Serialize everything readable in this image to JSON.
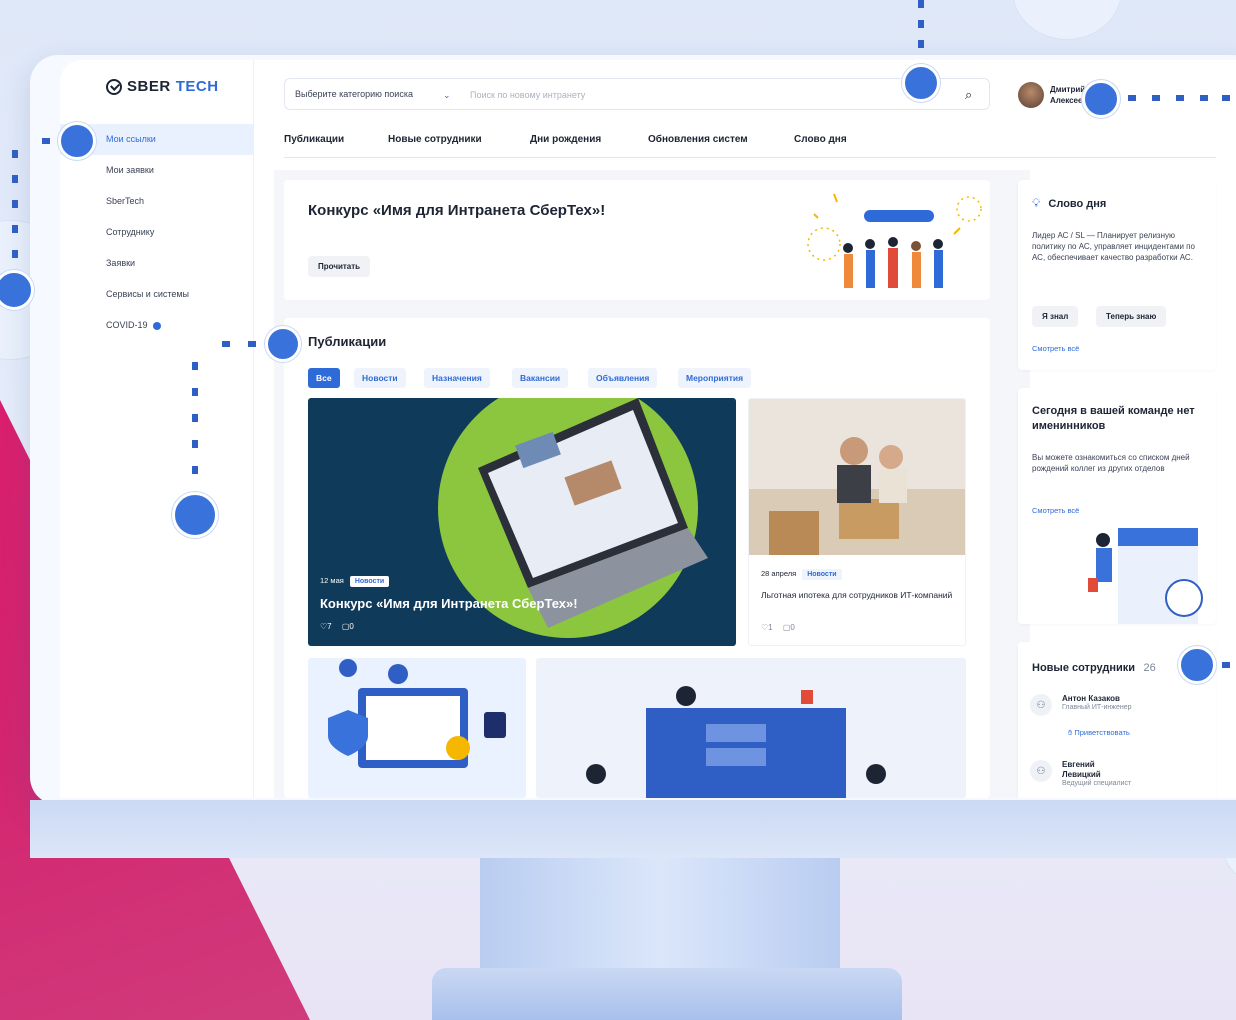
{
  "brand": {
    "part1": "SBER",
    "part2": "TECH"
  },
  "sidebar": {
    "items": [
      {
        "label": "Мои ссылки",
        "active": true
      },
      {
        "label": "Мои заявки"
      },
      {
        "label": "SberTech"
      },
      {
        "label": "Сотруднику"
      },
      {
        "label": "Заявки"
      },
      {
        "label": "Сервисы и системы"
      },
      {
        "label": "COVID-19"
      }
    ]
  },
  "search": {
    "category": "Выберите категорию поиска",
    "placeholder": "Поиск по новому интранету"
  },
  "user": {
    "name_line1": "Дмитрий",
    "name_line2": "Алексеевич"
  },
  "tabs": [
    "Публикации",
    "Новые сотрудники",
    "Дни рождения",
    "Обновления систем",
    "Слово дня"
  ],
  "banner": {
    "title": "Конкурс «Имя для Интранета СберТех»!",
    "button": "Прочитать"
  },
  "publications": {
    "title": "Публикации",
    "filters": [
      "Все",
      "Новости",
      "Назначения",
      "Вакансии",
      "Объявления",
      "Мероприятия"
    ],
    "featured": {
      "date": "12 мая",
      "tag": "Новости",
      "title": "Конкурс «Имя для Интранета СберТех»!",
      "likes": "7",
      "comments": "0"
    },
    "second": {
      "date": "28 апреля",
      "tag": "Новости",
      "title": "Льготная ипотека для сотрудников ИТ-компаний",
      "likes": "1",
      "comments": "0"
    }
  },
  "word_of_day": {
    "title": "Слово дня",
    "text": "Лидер АС / SL — Планирует релизную политику по АС, управляет инцидентами по АС, обеспечивает качество разработки АС.",
    "btn_know": "Я знал",
    "btn_now": "Теперь знаю",
    "link": "Смотреть всё"
  },
  "birthdays": {
    "title": "Сегодня в вашей команде нет именинников",
    "text": "Вы можете ознакомиться со списком дней рождений коллег из других отделов",
    "link": "Смотреть всё"
  },
  "new_employees": {
    "title": "Новые сотрудники",
    "count": "26",
    "items": [
      {
        "name": "Антон Казаков",
        "role": "Главный ИТ-инженер",
        "greet": "Приветствовать"
      },
      {
        "name": "Евгений Левицкий",
        "role": "Ведущий специалист"
      }
    ]
  },
  "colors": {
    "accent": "#2f6bd8",
    "pink": "#e0196a",
    "bg": "#e4ecf9"
  }
}
